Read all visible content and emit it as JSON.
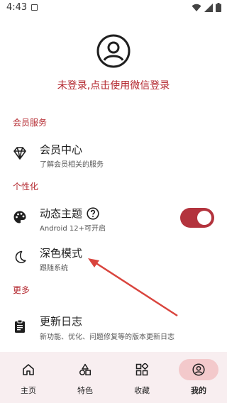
{
  "status_bar": {
    "time": "4:43"
  },
  "profile": {
    "login_text": "未登录,点击使用微信登录"
  },
  "sections": {
    "member_title": "会员服务",
    "personal_title": "个性化",
    "more_title": "更多"
  },
  "items": {
    "member_center": {
      "title": "会员中心",
      "subtitle": "了解会员相关的服务"
    },
    "dynamic_theme": {
      "title": "动态主题",
      "subtitle": "Android 12+可开启",
      "enabled": true
    },
    "dark_mode": {
      "title": "深色模式",
      "subtitle": "跟随系统"
    },
    "changelog": {
      "title": "更新日志",
      "subtitle": "新功能、优化、问题修复等的版本更新日志"
    }
  },
  "bottom_nav": {
    "items": [
      {
        "label": "主页",
        "icon": "home-icon"
      },
      {
        "label": "特色",
        "icon": "shapes-icon"
      },
      {
        "label": "收藏",
        "icon": "grid-icon"
      },
      {
        "label": "我的",
        "icon": "person-icon",
        "active": true
      }
    ]
  },
  "colors": {
    "accent": "#b3262d",
    "nav_bg": "#f8eef0",
    "nav_active_bg": "#f3c9cb",
    "toggle": "#b3333d"
  }
}
